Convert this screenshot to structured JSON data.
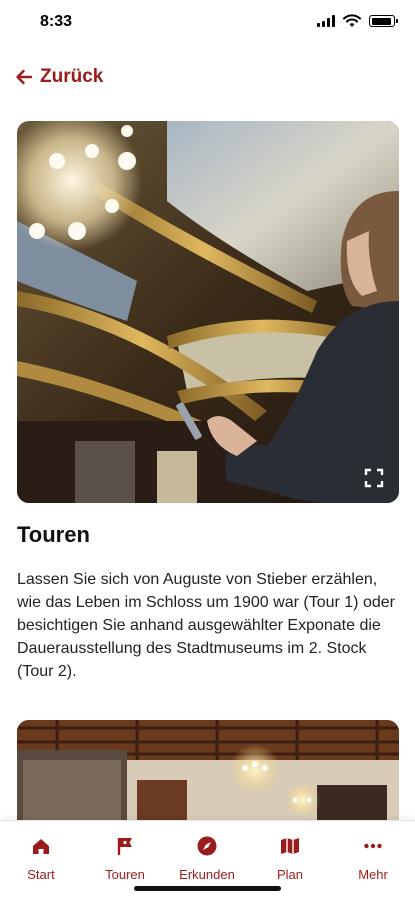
{
  "status_bar": {
    "time": "8:33"
  },
  "header": {
    "back_label": "Zurück"
  },
  "section": {
    "title": "Touren",
    "text": "Lassen Sie sich von Auguste von Stieber erzählen, wie das Leben im Schloss um 1900 war (Tour 1) oder besichtigen Sie anhand ausgewählter Exponate die Dauerausstellung des Stadtmuseums im 2. Stock (Tour 2)."
  },
  "tabs": [
    {
      "label": "Start",
      "icon": "home-icon"
    },
    {
      "label": "Touren",
      "icon": "flag-icon"
    },
    {
      "label": "Erkunden",
      "icon": "compass-icon"
    },
    {
      "label": "Plan",
      "icon": "map-icon"
    },
    {
      "label": "Mehr",
      "icon": "more-icon"
    }
  ],
  "colors": {
    "accent": "#9b1c1c",
    "background": "#ffffff",
    "text": "#111111"
  }
}
